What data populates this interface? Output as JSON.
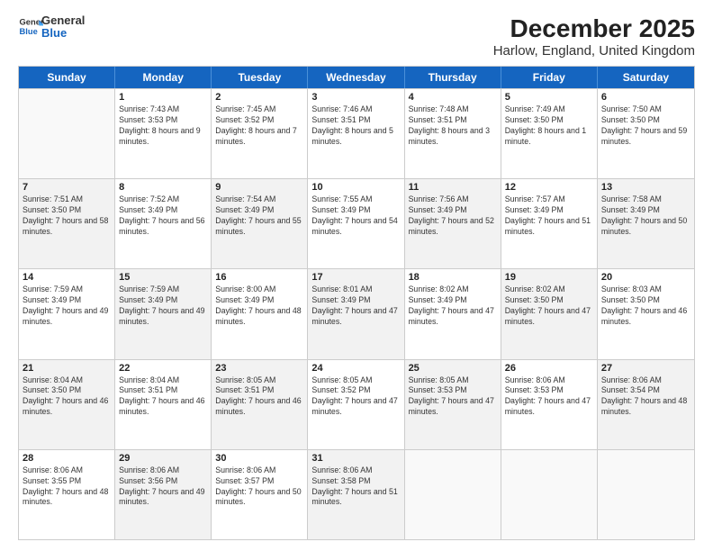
{
  "logo": {
    "line1": "General",
    "line2": "Blue"
  },
  "title": "December 2025",
  "subtitle": "Harlow, England, United Kingdom",
  "calendar": {
    "headers": [
      "Sunday",
      "Monday",
      "Tuesday",
      "Wednesday",
      "Thursday",
      "Friday",
      "Saturday"
    ],
    "rows": [
      [
        {
          "day": "",
          "info": "",
          "empty": true
        },
        {
          "day": "1",
          "info": "Sunrise: 7:43 AM\nSunset: 3:53 PM\nDaylight: 8 hours\nand 9 minutes."
        },
        {
          "day": "2",
          "info": "Sunrise: 7:45 AM\nSunset: 3:52 PM\nDaylight: 8 hours\nand 7 minutes."
        },
        {
          "day": "3",
          "info": "Sunrise: 7:46 AM\nSunset: 3:51 PM\nDaylight: 8 hours\nand 5 minutes."
        },
        {
          "day": "4",
          "info": "Sunrise: 7:48 AM\nSunset: 3:51 PM\nDaylight: 8 hours\nand 3 minutes."
        },
        {
          "day": "5",
          "info": "Sunrise: 7:49 AM\nSunset: 3:50 PM\nDaylight: 8 hours\nand 1 minute."
        },
        {
          "day": "6",
          "info": "Sunrise: 7:50 AM\nSunset: 3:50 PM\nDaylight: 7 hours\nand 59 minutes."
        }
      ],
      [
        {
          "day": "7",
          "info": "Sunrise: 7:51 AM\nSunset: 3:50 PM\nDaylight: 7 hours\nand 58 minutes.",
          "shaded": true
        },
        {
          "day": "8",
          "info": "Sunrise: 7:52 AM\nSunset: 3:49 PM\nDaylight: 7 hours\nand 56 minutes."
        },
        {
          "day": "9",
          "info": "Sunrise: 7:54 AM\nSunset: 3:49 PM\nDaylight: 7 hours\nand 55 minutes.",
          "shaded": true
        },
        {
          "day": "10",
          "info": "Sunrise: 7:55 AM\nSunset: 3:49 PM\nDaylight: 7 hours\nand 54 minutes."
        },
        {
          "day": "11",
          "info": "Sunrise: 7:56 AM\nSunset: 3:49 PM\nDaylight: 7 hours\nand 52 minutes.",
          "shaded": true
        },
        {
          "day": "12",
          "info": "Sunrise: 7:57 AM\nSunset: 3:49 PM\nDaylight: 7 hours\nand 51 minutes."
        },
        {
          "day": "13",
          "info": "Sunrise: 7:58 AM\nSunset: 3:49 PM\nDaylight: 7 hours\nand 50 minutes.",
          "shaded": true
        }
      ],
      [
        {
          "day": "14",
          "info": "Sunrise: 7:59 AM\nSunset: 3:49 PM\nDaylight: 7 hours\nand 49 minutes."
        },
        {
          "day": "15",
          "info": "Sunrise: 7:59 AM\nSunset: 3:49 PM\nDaylight: 7 hours\nand 49 minutes.",
          "shaded": true
        },
        {
          "day": "16",
          "info": "Sunrise: 8:00 AM\nSunset: 3:49 PM\nDaylight: 7 hours\nand 48 minutes."
        },
        {
          "day": "17",
          "info": "Sunrise: 8:01 AM\nSunset: 3:49 PM\nDaylight: 7 hours\nand 47 minutes.",
          "shaded": true
        },
        {
          "day": "18",
          "info": "Sunrise: 8:02 AM\nSunset: 3:49 PM\nDaylight: 7 hours\nand 47 minutes."
        },
        {
          "day": "19",
          "info": "Sunrise: 8:02 AM\nSunset: 3:50 PM\nDaylight: 7 hours\nand 47 minutes.",
          "shaded": true
        },
        {
          "day": "20",
          "info": "Sunrise: 8:03 AM\nSunset: 3:50 PM\nDaylight: 7 hours\nand 46 minutes."
        }
      ],
      [
        {
          "day": "21",
          "info": "Sunrise: 8:04 AM\nSunset: 3:50 PM\nDaylight: 7 hours\nand 46 minutes.",
          "shaded": true
        },
        {
          "day": "22",
          "info": "Sunrise: 8:04 AM\nSunset: 3:51 PM\nDaylight: 7 hours\nand 46 minutes."
        },
        {
          "day": "23",
          "info": "Sunrise: 8:05 AM\nSunset: 3:51 PM\nDaylight: 7 hours\nand 46 minutes.",
          "shaded": true
        },
        {
          "day": "24",
          "info": "Sunrise: 8:05 AM\nSunset: 3:52 PM\nDaylight: 7 hours\nand 47 minutes."
        },
        {
          "day": "25",
          "info": "Sunrise: 8:05 AM\nSunset: 3:53 PM\nDaylight: 7 hours\nand 47 minutes.",
          "shaded": true
        },
        {
          "day": "26",
          "info": "Sunrise: 8:06 AM\nSunset: 3:53 PM\nDaylight: 7 hours\nand 47 minutes."
        },
        {
          "day": "27",
          "info": "Sunrise: 8:06 AM\nSunset: 3:54 PM\nDaylight: 7 hours\nand 48 minutes.",
          "shaded": true
        }
      ],
      [
        {
          "day": "28",
          "info": "Sunrise: 8:06 AM\nSunset: 3:55 PM\nDaylight: 7 hours\nand 48 minutes."
        },
        {
          "day": "29",
          "info": "Sunrise: 8:06 AM\nSunset: 3:56 PM\nDaylight: 7 hours\nand 49 minutes.",
          "shaded": true
        },
        {
          "day": "30",
          "info": "Sunrise: 8:06 AM\nSunset: 3:57 PM\nDaylight: 7 hours\nand 50 minutes."
        },
        {
          "day": "31",
          "info": "Sunrise: 8:06 AM\nSunset: 3:58 PM\nDaylight: 7 hours\nand 51 minutes.",
          "shaded": true
        },
        {
          "day": "",
          "info": "",
          "empty": true
        },
        {
          "day": "",
          "info": "",
          "empty": true
        },
        {
          "day": "",
          "info": "",
          "empty": true
        }
      ]
    ]
  }
}
